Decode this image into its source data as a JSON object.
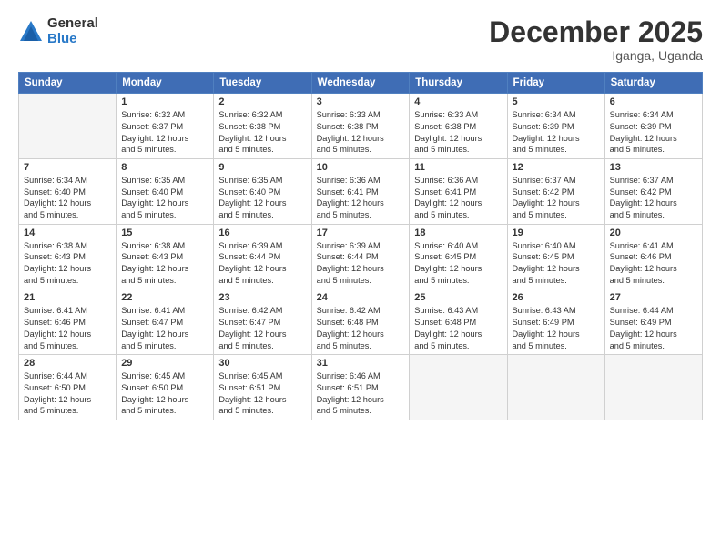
{
  "logo": {
    "general": "General",
    "blue": "Blue"
  },
  "title": "December 2025",
  "subtitle": "Iganga, Uganda",
  "headers": [
    "Sunday",
    "Monday",
    "Tuesday",
    "Wednesday",
    "Thursday",
    "Friday",
    "Saturday"
  ],
  "weeks": [
    [
      {
        "day": "",
        "info": ""
      },
      {
        "day": "1",
        "info": "Sunrise: 6:32 AM\nSunset: 6:37 PM\nDaylight: 12 hours\nand 5 minutes."
      },
      {
        "day": "2",
        "info": "Sunrise: 6:32 AM\nSunset: 6:38 PM\nDaylight: 12 hours\nand 5 minutes."
      },
      {
        "day": "3",
        "info": "Sunrise: 6:33 AM\nSunset: 6:38 PM\nDaylight: 12 hours\nand 5 minutes."
      },
      {
        "day": "4",
        "info": "Sunrise: 6:33 AM\nSunset: 6:38 PM\nDaylight: 12 hours\nand 5 minutes."
      },
      {
        "day": "5",
        "info": "Sunrise: 6:34 AM\nSunset: 6:39 PM\nDaylight: 12 hours\nand 5 minutes."
      },
      {
        "day": "6",
        "info": "Sunrise: 6:34 AM\nSunset: 6:39 PM\nDaylight: 12 hours\nand 5 minutes."
      }
    ],
    [
      {
        "day": "7",
        "info": "Sunrise: 6:34 AM\nSunset: 6:40 PM\nDaylight: 12 hours\nand 5 minutes."
      },
      {
        "day": "8",
        "info": "Sunrise: 6:35 AM\nSunset: 6:40 PM\nDaylight: 12 hours\nand 5 minutes."
      },
      {
        "day": "9",
        "info": "Sunrise: 6:35 AM\nSunset: 6:40 PM\nDaylight: 12 hours\nand 5 minutes."
      },
      {
        "day": "10",
        "info": "Sunrise: 6:36 AM\nSunset: 6:41 PM\nDaylight: 12 hours\nand 5 minutes."
      },
      {
        "day": "11",
        "info": "Sunrise: 6:36 AM\nSunset: 6:41 PM\nDaylight: 12 hours\nand 5 minutes."
      },
      {
        "day": "12",
        "info": "Sunrise: 6:37 AM\nSunset: 6:42 PM\nDaylight: 12 hours\nand 5 minutes."
      },
      {
        "day": "13",
        "info": "Sunrise: 6:37 AM\nSunset: 6:42 PM\nDaylight: 12 hours\nand 5 minutes."
      }
    ],
    [
      {
        "day": "14",
        "info": "Sunrise: 6:38 AM\nSunset: 6:43 PM\nDaylight: 12 hours\nand 5 minutes."
      },
      {
        "day": "15",
        "info": "Sunrise: 6:38 AM\nSunset: 6:43 PM\nDaylight: 12 hours\nand 5 minutes."
      },
      {
        "day": "16",
        "info": "Sunrise: 6:39 AM\nSunset: 6:44 PM\nDaylight: 12 hours\nand 5 minutes."
      },
      {
        "day": "17",
        "info": "Sunrise: 6:39 AM\nSunset: 6:44 PM\nDaylight: 12 hours\nand 5 minutes."
      },
      {
        "day": "18",
        "info": "Sunrise: 6:40 AM\nSunset: 6:45 PM\nDaylight: 12 hours\nand 5 minutes."
      },
      {
        "day": "19",
        "info": "Sunrise: 6:40 AM\nSunset: 6:45 PM\nDaylight: 12 hours\nand 5 minutes."
      },
      {
        "day": "20",
        "info": "Sunrise: 6:41 AM\nSunset: 6:46 PM\nDaylight: 12 hours\nand 5 minutes."
      }
    ],
    [
      {
        "day": "21",
        "info": "Sunrise: 6:41 AM\nSunset: 6:46 PM\nDaylight: 12 hours\nand 5 minutes."
      },
      {
        "day": "22",
        "info": "Sunrise: 6:41 AM\nSunset: 6:47 PM\nDaylight: 12 hours\nand 5 minutes."
      },
      {
        "day": "23",
        "info": "Sunrise: 6:42 AM\nSunset: 6:47 PM\nDaylight: 12 hours\nand 5 minutes."
      },
      {
        "day": "24",
        "info": "Sunrise: 6:42 AM\nSunset: 6:48 PM\nDaylight: 12 hours\nand 5 minutes."
      },
      {
        "day": "25",
        "info": "Sunrise: 6:43 AM\nSunset: 6:48 PM\nDaylight: 12 hours\nand 5 minutes."
      },
      {
        "day": "26",
        "info": "Sunrise: 6:43 AM\nSunset: 6:49 PM\nDaylight: 12 hours\nand 5 minutes."
      },
      {
        "day": "27",
        "info": "Sunrise: 6:44 AM\nSunset: 6:49 PM\nDaylight: 12 hours\nand 5 minutes."
      }
    ],
    [
      {
        "day": "28",
        "info": "Sunrise: 6:44 AM\nSunset: 6:50 PM\nDaylight: 12 hours\nand 5 minutes."
      },
      {
        "day": "29",
        "info": "Sunrise: 6:45 AM\nSunset: 6:50 PM\nDaylight: 12 hours\nand 5 minutes."
      },
      {
        "day": "30",
        "info": "Sunrise: 6:45 AM\nSunset: 6:51 PM\nDaylight: 12 hours\nand 5 minutes."
      },
      {
        "day": "31",
        "info": "Sunrise: 6:46 AM\nSunset: 6:51 PM\nDaylight: 12 hours\nand 5 minutes."
      },
      {
        "day": "",
        "info": ""
      },
      {
        "day": "",
        "info": ""
      },
      {
        "day": "",
        "info": ""
      }
    ]
  ]
}
